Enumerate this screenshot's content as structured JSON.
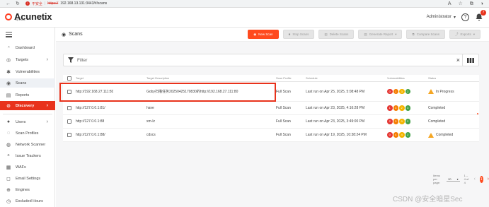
{
  "browser": {
    "security_label": "不安全",
    "url_scheme": "https://",
    "url_path": "192.168.13.131:3443/#/scans"
  },
  "app": {
    "logo_text": "Acunetix",
    "logo_sub": "by invicti",
    "user": "Administrator",
    "notification_count": "7"
  },
  "sidebar": {
    "items": [
      {
        "label": "Dashboard",
        "icon": "dashboard-icon",
        "glyph": "◔"
      },
      {
        "label": "Targets",
        "icon": "targets-icon",
        "glyph": "◎"
      },
      {
        "label": "Vulnerabilities",
        "icon": "bug-icon",
        "glyph": "✱"
      },
      {
        "label": "Scans",
        "icon": "scans-icon",
        "glyph": "◉"
      },
      {
        "label": "Reports",
        "icon": "reports-icon",
        "glyph": "▤"
      },
      {
        "label": "Discovery",
        "icon": "discovery-icon",
        "glyph": "⊘"
      },
      {
        "label": "Users",
        "icon": "users-icon",
        "glyph": "●"
      },
      {
        "label": "Scan Profiles",
        "icon": "scan-profiles-icon",
        "glyph": "◌"
      },
      {
        "label": "Network Scanner",
        "icon": "network-scanner-icon",
        "glyph": "◍"
      },
      {
        "label": "Issue Trackers",
        "icon": "issue-trackers-icon",
        "glyph": "◓"
      },
      {
        "label": "WAFs",
        "icon": "waf-icon",
        "glyph": "▦"
      },
      {
        "label": "Email Settings",
        "icon": "email-icon",
        "glyph": "◻"
      },
      {
        "label": "Engines",
        "icon": "engines-icon",
        "glyph": "⊕"
      },
      {
        "label": "Excluded Hours",
        "icon": "excluded-hours-icon",
        "glyph": "◷"
      }
    ]
  },
  "toolbar": {
    "title": "Scans",
    "new_scan": "New Scan",
    "stop_scans": "Stop Scans",
    "delete_scans": "Delete Scans",
    "generate_report": "Generate Report",
    "compare_scans": "Compare Scans",
    "exports": "Exports"
  },
  "filter": {
    "label": "Filter"
  },
  "table": {
    "headers": [
      "Target",
      "Target Description",
      "Scan Profile",
      "Schedule",
      "Vulnerabilities",
      "Status"
    ],
    "rows": [
      {
        "target": "http://192.168.27.111:80",
        "description": "Goby扫描任务20250425170830的http://192.168.27.111:80",
        "profile": "Full Scan",
        "schedule": "Last run on Apr 25, 2025, 5:08:48 PM",
        "vulns": [
          "0",
          "1",
          "3",
          "2"
        ],
        "status": "In Progress"
      },
      {
        "target": "http://127.0.0.1:81/",
        "description": "have",
        "profile": "Full Scan",
        "schedule": "Last run on Apr 23, 2025, 4:16:28 PM",
        "vulns": [
          "1",
          "3",
          "2",
          "3"
        ],
        "status": "Completed"
      },
      {
        "target": "http://127.0.0.1:88",
        "description": "xm-lz",
        "profile": "Full Scan",
        "schedule": "Last run on Apr 23, 2025, 3:49:00 PM",
        "vulns": [
          "2",
          "3",
          "0",
          "2"
        ],
        "status": "Completed"
      },
      {
        "target": "http://127.0.0.1:88/",
        "description": "cdscs",
        "profile": "Full Scan",
        "schedule": "Last run on Apr 19, 2025, 10:38:24 PM",
        "vulns": [
          "0",
          "4",
          "4",
          "2"
        ],
        "status": "Completed"
      }
    ],
    "vuln_colors": [
      "#e53935",
      "#f57c00",
      "#f4b400",
      "#43a047"
    ]
  },
  "pagination": {
    "items_per_page_label": "Items per page:",
    "items_per_page": "20",
    "range": "1 – 4 of 4",
    "current_page": "1"
  },
  "watermark": "CSDN @安全暗星Sec"
}
